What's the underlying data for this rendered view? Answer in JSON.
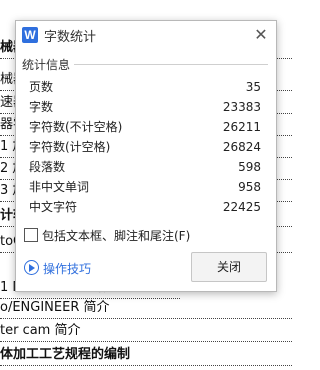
{
  "document": {
    "lines": [
      "械器",
      "械器",
      "速器",
      "器零",
      "1 加",
      "2 加",
      "3 加",
      "计软",
      "toCA",
      "1 Mastercam的概",
      "o/ENGINEER 简介",
      "ter cam 简介",
      "体加工工艺规程的编制"
    ]
  },
  "dialog": {
    "app_icon_letter": "W",
    "title": "字数统计",
    "close_glyph": "✕",
    "section_label": "统计信息",
    "stats": [
      {
        "label": "页数",
        "value": "35"
      },
      {
        "label": "字数",
        "value": "23383"
      },
      {
        "label": "字符数(不计空格)",
        "value": "26211"
      },
      {
        "label": "字符数(计空格)",
        "value": "26824"
      },
      {
        "label": "段落数",
        "value": "598"
      },
      {
        "label": "非中文单词",
        "value": "958"
      },
      {
        "label": "中文字符",
        "value": "22425"
      }
    ],
    "include_textboxes": {
      "label": "包括文本框、脚注和尾注(F)",
      "checked": false
    },
    "tips_label": "操作技巧",
    "close_button_label": "关闭"
  },
  "colors": {
    "accent": "#2f6fde"
  }
}
